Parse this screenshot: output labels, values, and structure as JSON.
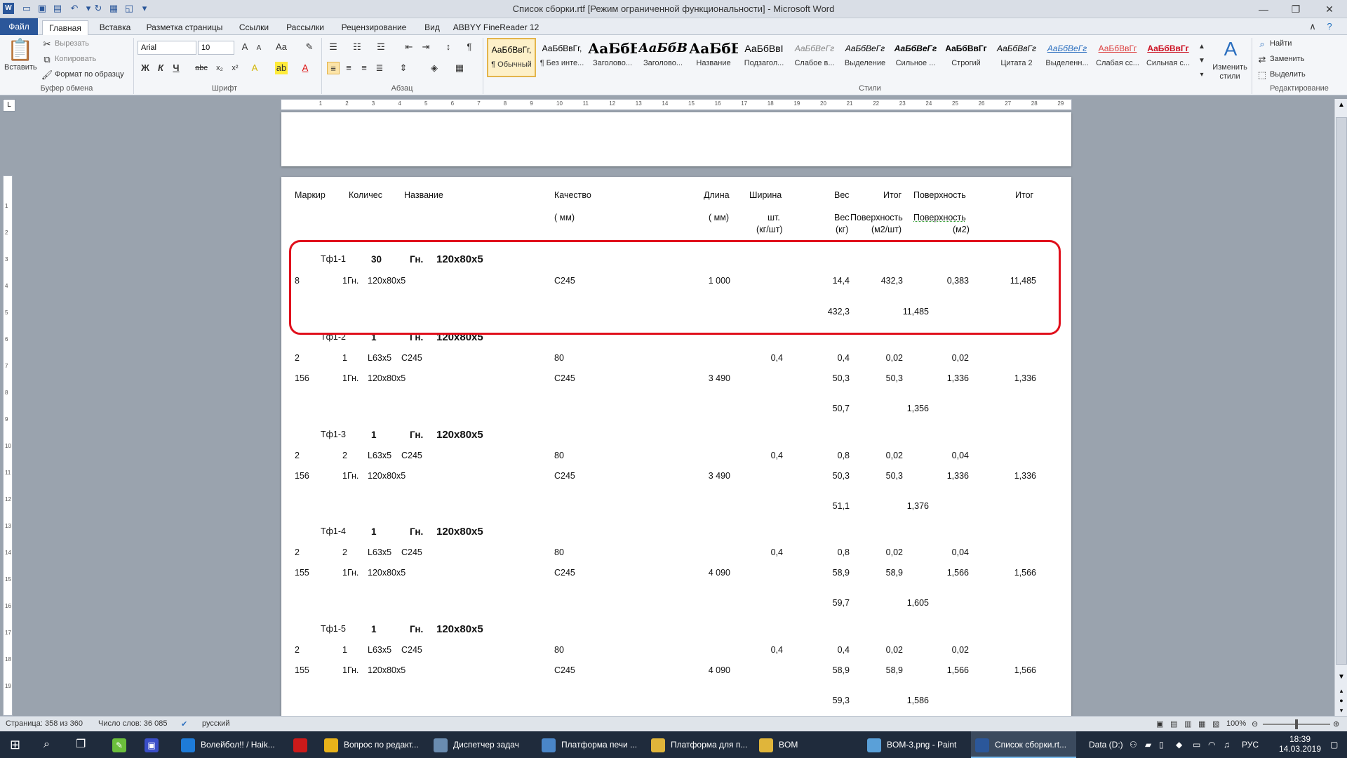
{
  "window": {
    "title": "Список сборки.rtf [Режим ограниченной функциональности] - Microsoft Word",
    "minimize_icon": "minimize-icon",
    "restore_icon": "restore-icon",
    "close_icon": "close-icon"
  },
  "ribbon_tabs": [
    "Файл",
    "Главная",
    "Вставка",
    "Разметка страницы",
    "Ссылки",
    "Рассылки",
    "Рецензирование",
    "Вид",
    "ABBYY FineReader 12"
  ],
  "clipboard": {
    "paste": "Вставить",
    "cut": "Вырезать",
    "copy": "Копировать",
    "format_painter": "Формат по образцу",
    "group": "Буфер обмена"
  },
  "font": {
    "name": "Arial",
    "size": "10",
    "group": "Шрифт"
  },
  "paragraph": {
    "group": "Абзац"
  },
  "styles": {
    "group": "Стили",
    "items": [
      {
        "sample": "АаБбВвГг,",
        "name": "¶ Обычный"
      },
      {
        "sample": "АаБбВвГг,",
        "name": "¶ Без инте..."
      },
      {
        "sample": "АаБбЕ",
        "name": "Заголово..."
      },
      {
        "sample": "АаБбВ",
        "name": "Заголово..."
      },
      {
        "sample": "АаБбЕ",
        "name": "Название"
      },
      {
        "sample": "АаБбВвІ",
        "name": "Подзагол..."
      },
      {
        "sample": "АаБбВеГг",
        "name": "Слабое в..."
      },
      {
        "sample": "АаБбВеГг",
        "name": "Выделение"
      },
      {
        "sample": "АаБбВеГг",
        "name": "Сильное ..."
      },
      {
        "sample": "АаБбВвГг",
        "name": "Строгий"
      },
      {
        "sample": "АаБбВвГг",
        "name": "Цитата 2"
      },
      {
        "sample": "АаБбВеГг",
        "name": "Выделенн..."
      },
      {
        "sample": "АаБбВвГг",
        "name": "Слабая сс..."
      },
      {
        "sample": "АаБбВвГг",
        "name": "Сильная с..."
      }
    ],
    "change": "Изменить стили"
  },
  "editing": {
    "find": "Найти",
    "replace": "Заменить",
    "select": "Выделить",
    "group": "Редактирование"
  },
  "document": {
    "headers1": [
      "Маркир",
      "Количес",
      "Название",
      "Качество",
      "Длина",
      "Ширина",
      "Вес",
      "Итог",
      "Поверхность",
      "Итог"
    ],
    "headers2": [
      "( мм)",
      "( мм)",
      "шт.",
      "Вес",
      "Поверхность",
      "Поверхность"
    ],
    "headers3": [
      "(кг/шт)",
      "(кг)",
      "(м2/шт)",
      "(м2)"
    ],
    "assemblies": [
      {
        "mark": "Тф1-1",
        "qty": "30",
        "type": "Гн.",
        "profile": "120x80x5",
        "rows": [
          {
            "c1": "8",
            "c2": "1Гн.",
            "c3": "120x80x5",
            "c4": "",
            "c5": "С245",
            "c6": "1 000",
            "c7": "",
            "c8": "14,4",
            "c9": "432,3",
            "c10": "0,383",
            "c11": "11,485"
          }
        ],
        "total_w": "432,3",
        "total_s": "11,485"
      },
      {
        "mark": "Тф1-2",
        "qty": "1",
        "type": "Гн.",
        "profile": "120x80x5",
        "rows": [
          {
            "c1": "2",
            "c2": "1",
            "c3": "L63x5",
            "c4": "С245",
            "c5": "80",
            "c6": "",
            "c7": "0,4",
            "c8": "0,4",
            "c9": "0,02",
            "c10": "0,02",
            "c11": ""
          },
          {
            "c1": "156",
            "c2": "1Гн.",
            "c3": "120x80x5",
            "c4": "",
            "c5": "С245",
            "c6": "3 490",
            "c7": "",
            "c8": "50,3",
            "c9": "50,3",
            "c10": "1,336",
            "c11": "1,336"
          }
        ],
        "total_w": "50,7",
        "total_s": "1,356"
      },
      {
        "mark": "Тф1-3",
        "qty": "1",
        "type": "Гн.",
        "profile": "120x80x5",
        "rows": [
          {
            "c1": "2",
            "c2": "2",
            "c3": "L63x5",
            "c4": "С245",
            "c5": "80",
            "c6": "",
            "c7": "0,4",
            "c8": "0,8",
            "c9": "0,02",
            "c10": "0,04",
            "c11": ""
          },
          {
            "c1": "156",
            "c2": "1Гн.",
            "c3": "120x80x5",
            "c4": "",
            "c5": "С245",
            "c6": "3 490",
            "c7": "",
            "c8": "50,3",
            "c9": "50,3",
            "c10": "1,336",
            "c11": "1,336"
          }
        ],
        "total_w": "51,1",
        "total_s": "1,376"
      },
      {
        "mark": "Тф1-4",
        "qty": "1",
        "type": "Гн.",
        "profile": "120x80x5",
        "rows": [
          {
            "c1": "2",
            "c2": "2",
            "c3": "L63x5",
            "c4": "С245",
            "c5": "80",
            "c6": "",
            "c7": "0,4",
            "c8": "0,8",
            "c9": "0,02",
            "c10": "0,04",
            "c11": ""
          },
          {
            "c1": "155",
            "c2": "1Гн.",
            "c3": "120x80x5",
            "c4": "",
            "c5": "С245",
            "c6": "4 090",
            "c7": "",
            "c8": "58,9",
            "c9": "58,9",
            "c10": "1,566",
            "c11": "1,566"
          }
        ],
        "total_w": "59,7",
        "total_s": "1,605"
      },
      {
        "mark": "Тф1-5",
        "qty": "1",
        "type": "Гн.",
        "profile": "120x80x5",
        "rows": [
          {
            "c1": "2",
            "c2": "1",
            "c3": "L63x5",
            "c4": "С245",
            "c5": "80",
            "c6": "",
            "c7": "0,4",
            "c8": "0,4",
            "c9": "0,02",
            "c10": "0,02",
            "c11": ""
          },
          {
            "c1": "155",
            "c2": "1Гн.",
            "c3": "120x80x5",
            "c4": "",
            "c5": "С245",
            "c6": "4 090",
            "c7": "",
            "c8": "58,9",
            "c9": "58,9",
            "c10": "1,566",
            "c11": "1,566"
          }
        ],
        "total_w": "59,3",
        "total_s": "1,586"
      }
    ]
  },
  "status": {
    "page": "Страница: 358 из 360",
    "words": "Число слов: 36 085",
    "lang": "русский",
    "zoom": "100%"
  },
  "taskbar": {
    "items": [
      {
        "label": "Волейбол!! / Haik...",
        "icon": "edge-icon",
        "color": "#1e7bd8"
      },
      {
        "label": "",
        "icon": "opera-icon",
        "color": "#cc1a1a"
      },
      {
        "label": "Вопрос по редакт...",
        "icon": "chrome-icon",
        "color": "#e8b21a"
      },
      {
        "label": "Диспетчер задач",
        "icon": "task-manager-icon",
        "color": "#6a8cb0"
      },
      {
        "label": "Платформа печи ...",
        "icon": "document-icon",
        "color": "#4a86c8"
      },
      {
        "label": "Платформа для п...",
        "icon": "folder-icon",
        "color": "#e0b53a"
      },
      {
        "label": "BOM",
        "icon": "folder-icon",
        "color": "#e0b53a"
      },
      {
        "label": "BOM-3.png - Paint",
        "icon": "paint-icon",
        "color": "#5aa0d8"
      },
      {
        "label": "Список сборки.rt...",
        "icon": "word-icon",
        "color": "#2b579a"
      }
    ],
    "tray_drive": "Data (D:)",
    "tray_lang": "РУС",
    "time": "18:39",
    "date": "14.03.2019"
  }
}
